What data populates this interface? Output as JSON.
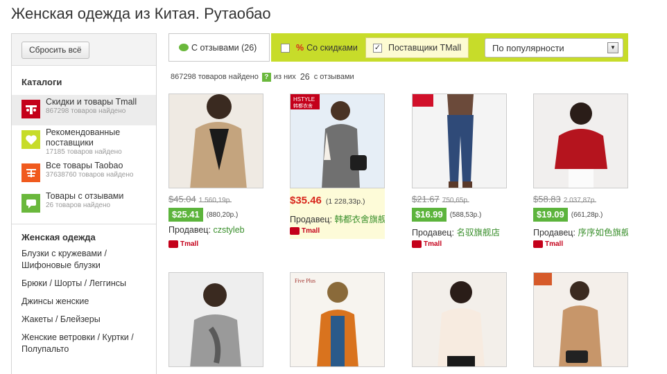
{
  "page_title": "Женская одежда из Китая. Рутаобао",
  "sidebar": {
    "reset_label": "Сбросить всё",
    "catalogs_title": "Каталоги",
    "catalogs": [
      {
        "label": "Скидки и товары Tmall",
        "count": "867298 товаров найдено",
        "icon": "tmall-cat-icon",
        "color": "#c4001a",
        "active": true
      },
      {
        "label": "Рекомендованные поставщики",
        "count": "17185 товаров найдено",
        "icon": "heart-icon",
        "color": "#c7dc2a",
        "active": false
      },
      {
        "label": "Все товары Taobao",
        "count": "37638760 товаров найдено",
        "icon": "taobao-icon",
        "color": "#f05a1e",
        "active": false
      },
      {
        "label": "Товары с отзывами",
        "count": "26 товаров найдено",
        "icon": "comment-icon",
        "color": "#6ab83c",
        "active": false
      }
    ],
    "women_title": "Женская одежда",
    "women_items": [
      "Блузки с кружевами / Шифоновые блузки",
      "Брюки / Шорты / Леггинсы",
      "Джинсы женские",
      "Жакеты / Блейзеры",
      "Женские ветровки / Куртки / Полупальто"
    ]
  },
  "filters": {
    "reviews_tab": "С отзывами (26)",
    "discount_pct": "%",
    "discount_label": "Со скидками",
    "tmall_label": "Поставщики TMall",
    "tmall_checked": "✓",
    "sort_selected": "По популярности"
  },
  "found": {
    "count_text": "867298 товаров найдено",
    "q": "?",
    "of_them": "из них",
    "reviews_count": "26",
    "with_reviews": "с отзывами"
  },
  "seller_label": "Продавец:",
  "tmall_text": "Tmall",
  "products": [
    {
      "old_usd": "$45.04",
      "old_rub": "1 560,19р.",
      "usd": "$25.41",
      "rub": "(880,20р.)",
      "seller": "czstyleb",
      "has_discount": true
    },
    {
      "usd": "$35.46",
      "rub": "(1 228,33р.)",
      "seller": "韩都衣舍旗舰",
      "has_discount": false
    },
    {
      "old_usd": "$21.67",
      "old_rub": "750,65р.",
      "usd": "$16.99",
      "rub": "(588,53р.)",
      "seller": "名驭旗舰店",
      "has_discount": true
    },
    {
      "old_usd": "$58.83",
      "old_rub": "2 037,87р.",
      "usd": "$19.09",
      "rub": "(661,28р.)",
      "seller": "序序如色旗舰",
      "has_discount": true
    }
  ],
  "thumb_labels": [
    "HSTYLE",
    "韩都衣舍",
    "Five Plus"
  ]
}
